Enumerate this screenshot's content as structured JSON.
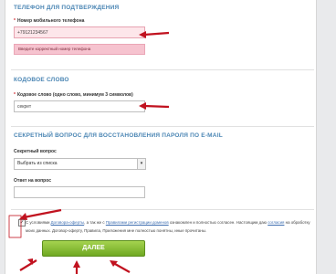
{
  "phone_section": {
    "title": "ТЕЛЕФОН ДЛЯ ПОДТВЕРЖДЕНИЯ",
    "label": "Номер мобильного телефона",
    "value": "+79121234567",
    "error": "Введите корректный номер телефона"
  },
  "codeword_section": {
    "title": "КОДОВОЕ СЛОВО",
    "label": "Кодовое слово (одно слово, минимум 3 символов)",
    "value": "секрет"
  },
  "secret_section": {
    "title": "СЕКРЕТНЫЙ ВОПРОС ДЛЯ ВОССТАНОВЛЕНИЯ ПАРОЛЯ ПО E-MAIL",
    "question_label": "Секретный вопрос",
    "question_selected": "Выбрать из списка",
    "answer_label": "Ответ на вопрос",
    "answer_value": ""
  },
  "consent": {
    "checked": "✓",
    "t1": "С условиями ",
    "link1": "Договора-оферты",
    "t2": ", а так же с ",
    "link2": "Правилами регистрации доменов",
    "t3": " ознакомлен и полностью согласен. Настоящим даю ",
    "link3": "согласия",
    "t4": " на обработку моих данных. Договор-оферту, Правила, Приложения мне полностью понятны, иные прочитаны."
  },
  "submit_label": "ДАЛЕЕ",
  "required_mark": "*",
  "colors": {
    "accent": "#4b86b4",
    "error_bg": "#f6c3cf",
    "submit": "#7db62b",
    "annotation": "#c1121f"
  }
}
